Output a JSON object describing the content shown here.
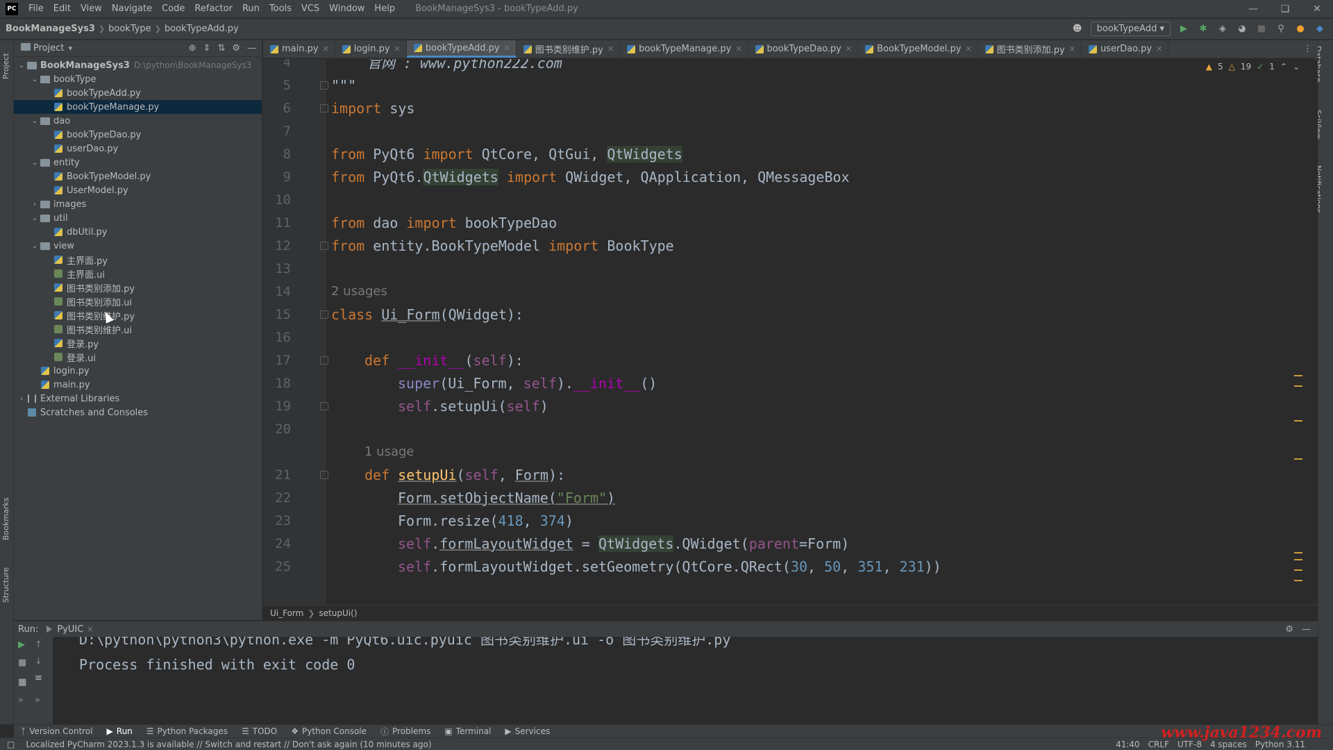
{
  "app": {
    "logo": "PC",
    "menu": [
      "File",
      "Edit",
      "View",
      "Navigate",
      "Code",
      "Refactor",
      "Run",
      "Tools",
      "VCS",
      "Window",
      "Help"
    ],
    "window_title": "BookManageSys3 - bookTypeAdd.py"
  },
  "navbar": {
    "crumbs": [
      "BookManageSys3",
      "bookType",
      "bookTypeAdd.py"
    ],
    "run_config": "bookTypeAdd"
  },
  "left_strip": {
    "project": "Project",
    "bookmarks": "Bookmarks",
    "structure": "Structure"
  },
  "right_strip": {
    "database": "Database",
    "sciview": "SciView",
    "notifications": "Notifications"
  },
  "project": {
    "title": "Project",
    "tree": [
      {
        "label": "BookManageSys3",
        "path": "D:\\python\\BookManageSys3",
        "type": "folder",
        "depth": 0,
        "open": true,
        "bold": true
      },
      {
        "label": "bookType",
        "type": "folder",
        "depth": 1,
        "open": true
      },
      {
        "label": "bookTypeAdd.py",
        "type": "py",
        "depth": 2
      },
      {
        "label": "bookTypeManage.py",
        "type": "py",
        "depth": 2,
        "selected": true
      },
      {
        "label": "dao",
        "type": "folder",
        "depth": 1,
        "open": true
      },
      {
        "label": "bookTypeDao.py",
        "type": "py",
        "depth": 2
      },
      {
        "label": "userDao.py",
        "type": "py",
        "depth": 2
      },
      {
        "label": "entity",
        "type": "folder",
        "depth": 1,
        "open": true
      },
      {
        "label": "BookTypeModel.py",
        "type": "py",
        "depth": 2
      },
      {
        "label": "UserModel.py",
        "type": "py",
        "depth": 2
      },
      {
        "label": "images",
        "type": "folder",
        "depth": 1,
        "open": false
      },
      {
        "label": "util",
        "type": "folder",
        "depth": 1,
        "open": true
      },
      {
        "label": "dbUtil.py",
        "type": "py",
        "depth": 2
      },
      {
        "label": "view",
        "type": "folder",
        "depth": 1,
        "open": true
      },
      {
        "label": "主界面.py",
        "type": "py",
        "depth": 2
      },
      {
        "label": "主界面.ui",
        "type": "ui",
        "depth": 2
      },
      {
        "label": "图书类别添加.py",
        "type": "py",
        "depth": 2
      },
      {
        "label": "图书类别添加.ui",
        "type": "ui",
        "depth": 2
      },
      {
        "label": "图书类别维护.py",
        "type": "py",
        "depth": 2
      },
      {
        "label": "图书类别维护.ui",
        "type": "ui",
        "depth": 2
      },
      {
        "label": "登录.py",
        "type": "py",
        "depth": 2
      },
      {
        "label": "登录.ui",
        "type": "ui",
        "depth": 2
      },
      {
        "label": "login.py",
        "type": "py",
        "depth": 1
      },
      {
        "label": "main.py",
        "type": "py",
        "depth": 1
      },
      {
        "label": "External Libraries",
        "type": "lib",
        "depth": 0,
        "open": false
      },
      {
        "label": "Scratches and Consoles",
        "type": "scratch",
        "depth": 0
      }
    ]
  },
  "tabs": [
    {
      "label": "main.py"
    },
    {
      "label": "login.py"
    },
    {
      "label": "bookTypeAdd.py",
      "active": true
    },
    {
      "label": "图书类别维护.py"
    },
    {
      "label": "bookTypeManage.py"
    },
    {
      "label": "bookTypeDao.py"
    },
    {
      "label": "BookTypeModel.py"
    },
    {
      "label": "图书类别添加.py"
    },
    {
      "label": "userDao.py"
    }
  ],
  "inspections": {
    "warnings": "5",
    "weak": "19",
    "ok": "1"
  },
  "editor": {
    "line4_text": "官网 : www.python222.com",
    "line5_text": "\"\"\"",
    "usages_15": "2 usages",
    "usages_21": "1 usage",
    "line_numbers": [
      "4",
      "5",
      "6",
      "7",
      "8",
      "9",
      "10",
      "11",
      "12",
      "13",
      "14",
      "15",
      "16",
      "17",
      "18",
      "19",
      "20",
      "21",
      "22",
      "23",
      "24",
      "25"
    ]
  },
  "edcrumb": [
    "Ui_Form",
    "setupUi()"
  ],
  "run": {
    "label": "Run:",
    "tab": "PyUIC",
    "cut_line": "D:\\python\\python3\\python.exe -m PyQt6.uic.pyuic 图书类别维护.ui -o 图书类别维护.py",
    "finished": "Process finished with exit code 0"
  },
  "tooltabs": [
    "Version Control",
    "Run",
    "Python Packages",
    "TODO",
    "Python Console",
    "Problems",
    "Terminal",
    "Services"
  ],
  "status": {
    "message": "Localized PyCharm 2023.1.3 is available // Switch and restart // Don't ask again (10 minutes ago)",
    "position": "41:40",
    "line_sep": "CRLF",
    "encoding": "UTF-8",
    "indent": "4 spaces",
    "interpreter": "Python 3.11"
  },
  "watermark": "www.java1234.com"
}
